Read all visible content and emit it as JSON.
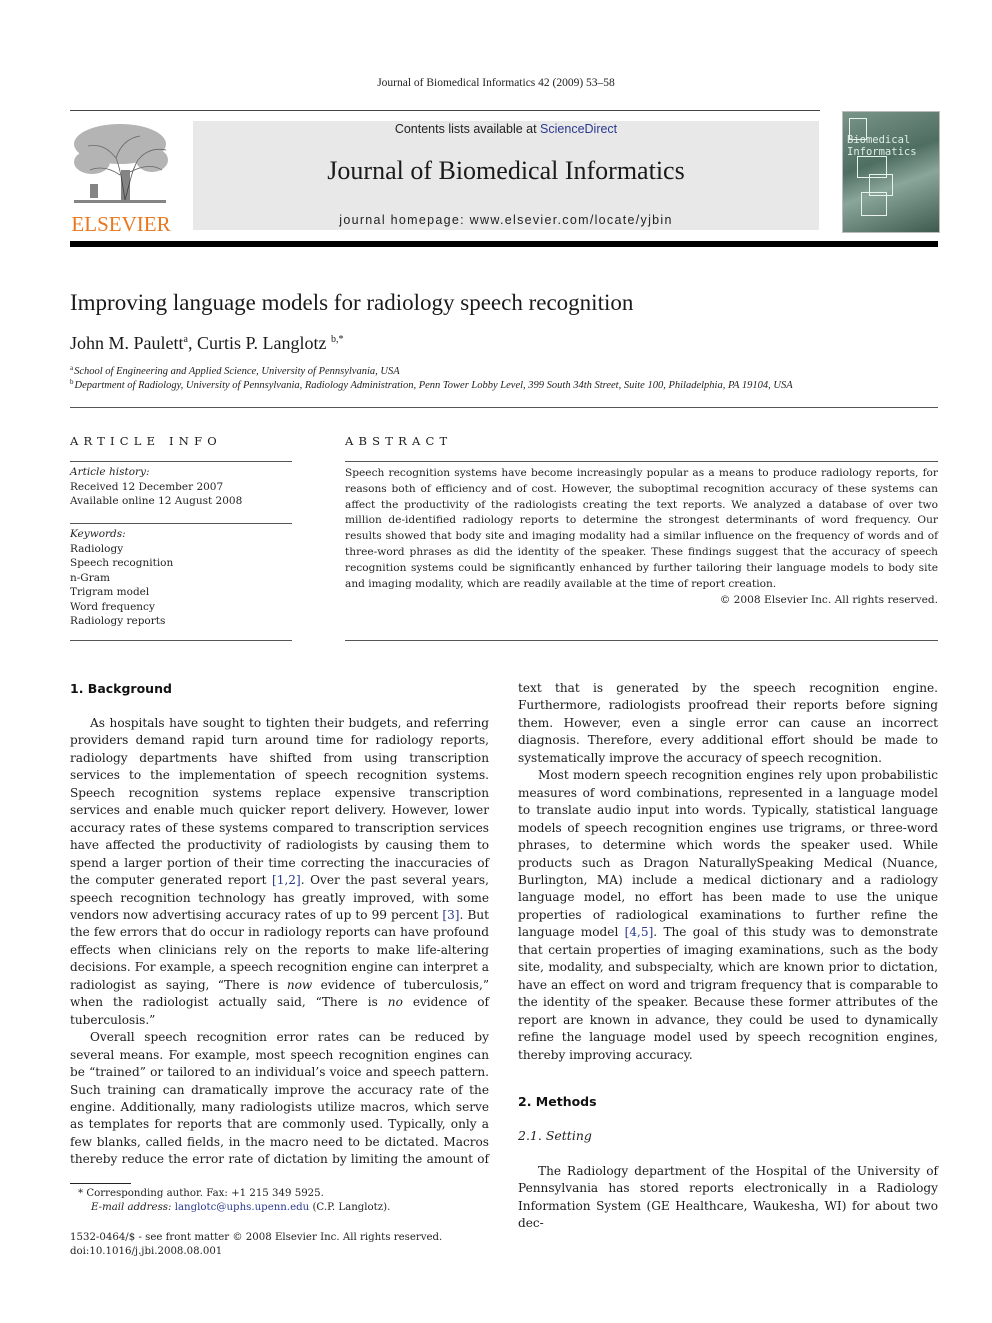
{
  "running_head": "Journal of Biomedical Informatics 42 (2009) 53–58",
  "masthead": {
    "publisher_word": "ELSEVIER",
    "contents_prefix": "Contents lists available at ",
    "contents_link": "ScienceDirect",
    "journal_title": "Journal of Biomedical Informatics",
    "homepage": "journal homepage: www.elsevier.com/locate/yjbin",
    "cover_title_line1": "Biomedical",
    "cover_title_line2": "Informatics"
  },
  "article": {
    "title": "Improving language models for radiology speech recognition",
    "authors": [
      {
        "name": "John M. Paulett",
        "sup": "a"
      },
      {
        "name": "Curtis P. Langlotz",
        "sup": "b,*"
      }
    ],
    "author_separator": ", ",
    "affiliations": [
      {
        "mark": "a",
        "text": "School of Engineering and Applied Science, University of Pennsylvania, USA"
      },
      {
        "mark": "b",
        "text": "Department of Radiology, University of Pennsylvania, Radiology Administration, Penn Tower Lobby Level, 399 South 34th Street, Suite 100, Philadelphia, PA 19104, USA"
      }
    ]
  },
  "article_info": {
    "heading": "ARTICLE INFO",
    "history_label": "Article history:",
    "received": "Received 12 December 2007",
    "available": "Available online 12 August 2008",
    "keywords_label": "Keywords:",
    "keywords": [
      "Radiology",
      "Speech recognition",
      "n-Gram",
      "Trigram model",
      "Word frequency",
      "Radiology reports"
    ]
  },
  "abstract": {
    "heading": "ABSTRACT",
    "text": "Speech recognition systems have become increasingly popular as a means to produce radiology reports, for reasons both of efficiency and of cost. However, the suboptimal recognition accuracy of these systems can affect the productivity of the radiologists creating the text reports. We analyzed a database of over two million de-identified radiology reports to determine the strongest determinants of word frequency. Our results showed that body site and imaging modality had a similar influence on the frequency of words and of three-word phrases as did the identity of the speaker. These findings suggest that the accuracy of speech recognition systems could be significantly enhanced by further tailoring their language models to body site and imaging modality, which are readily available at the time of report creation.",
    "copyright": "© 2008 Elsevier Inc. All rights reserved."
  },
  "body": {
    "section1_heading": "1. Background",
    "s1p1_a": "As hospitals have sought to tighten their budgets, and referring providers demand rapid turn around time for radiology reports, radiology departments have shifted from using transcription services to the implementation of speech recognition systems. Speech recognition systems replace expensive transcription services and enable much quicker report delivery. However, lower accuracy rates of these systems compared to transcription services have affected the productivity of radiologists by causing them to spend a larger portion of their time correcting the inaccuracies of the computer generated report ",
    "s1p1_ref1": "[1,2]",
    "s1p1_b": ". Over the past several years, speech recognition technology has greatly improved, with some vendors now advertising accuracy rates of up to 99 percent ",
    "s1p1_ref2": "[3]",
    "s1p1_c": ". But the few errors that do occur in radiology reports can have profound effects when clinicians rely on the reports to make life-altering decisions. For example, a speech recognition engine can interpret a radiologist as saying, “There is ",
    "s1p1_em1": "now",
    "s1p1_d": " evidence of tuberculosis,” when the radiologist actually said, “There is ",
    "s1p1_em2": "no",
    "s1p1_e": " evidence of tuberculosis.”",
    "s1p2_left": "Overall speech recognition error rates can be reduced by several means. For example, most speech recognition engines can be “trained” or tailored to an individual’s voice and speech pattern. Such training can dramatically improve the accuracy rate of the engine. Additionally, many radiologists utilize macros, which serve as templates for reports that are commonly used. Typically, only a few blanks, called fields, in the macro need to be dictated. Macros thereby reduce the error rate of dictation by limiting the amount of",
    "s1p2_right": "text that is generated by the speech recognition engine. Furthermore, radiologists proofread their reports before signing them. However, even a single error can cause an incorrect diagnosis. Therefore, every additional effort should be made to systematically improve the accuracy of speech recognition.",
    "s1p3_a": "Most modern speech recognition engines rely upon probabilistic measures of word combinations, represented in a language model to translate audio input into words. Typically, statistical language models of speech recognition engines use trigrams, or three-word phrases, to determine which words the speaker used. While products such as Dragon NaturallySpeaking Medical (Nuance, Burlington, MA) include a medical dictionary and a radiology language model, no effort has been made to use the unique properties of radiological examinations to further refine the language model ",
    "s1p3_ref": "[4,5]",
    "s1p3_b": ". The goal of this study was to demonstrate that certain properties of imaging examinations, such as the body site, modality, and subspecialty, which are known prior to dictation, have an effect on word and trigram frequency that is comparable to the identity of the speaker. Because these former attributes of the report are known in advance, they could be used to dynamically refine the language model used by speech recognition engines, thereby improving accuracy.",
    "section2_heading": "2. Methods",
    "subsection21_heading": "2.1. Setting",
    "s21p1": "The Radiology department of the Hospital of the University of Pennsylvania has stored reports electronically in a Radiology Information System (GE Healthcare, Waukesha, WI) for about two dec-"
  },
  "footnotes": {
    "corresponding": "* Corresponding author. Fax: +1 215 349 5925.",
    "email_label": "E-mail address: ",
    "email": "langlotc@uphs.upenn.edu",
    "email_suffix": " (C.P. Langlotz).",
    "issn_line": "1532-0464/$ - see front matter © 2008 Elsevier Inc. All rights reserved.",
    "doi": "doi:10.1016/j.jbi.2008.08.001"
  }
}
